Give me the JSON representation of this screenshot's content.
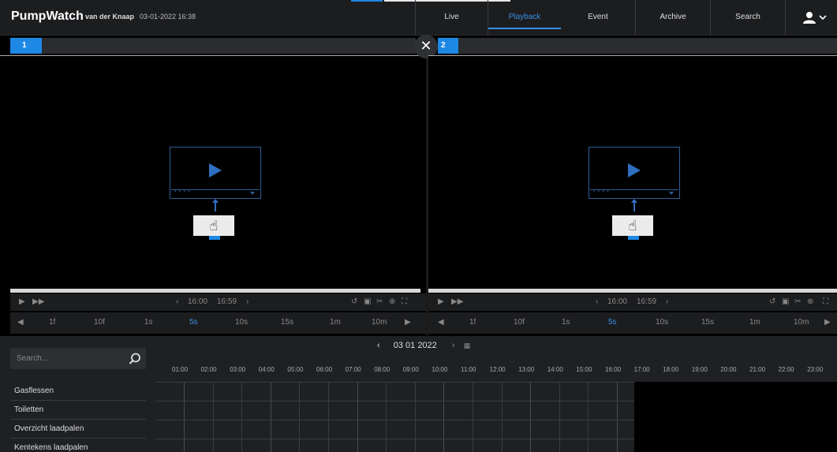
{
  "header": {
    "brand": "PumpWatch",
    "site": "van der Knaap",
    "datetime": "03-01-2022 16:38"
  },
  "nav": [
    {
      "label": "Live",
      "active": false
    },
    {
      "label": "Playback",
      "active": true
    },
    {
      "label": "Event",
      "active": false
    },
    {
      "label": "Archive",
      "active": false
    },
    {
      "label": "Search",
      "active": false
    }
  ],
  "panes": [
    {
      "number": "1",
      "time_start": "16:00",
      "time_end": "16:59"
    },
    {
      "number": "2",
      "time_start": "16:00",
      "time_end": "16:59"
    }
  ],
  "speeds": [
    "1f",
    "10f",
    "1s",
    "5s",
    "10s",
    "15s",
    "1m",
    "10m"
  ],
  "selected_speed": "5s",
  "search": {
    "placeholder": "Search..."
  },
  "timeline": {
    "date": "03 01 2022",
    "hours": [
      "01:00",
      "02:00",
      "03:00",
      "04:00",
      "05:00",
      "06:00",
      "07:00",
      "08:00",
      "09:00",
      "10:00",
      "11:00",
      "12:00",
      "13:00",
      "14:00",
      "15:00",
      "16:00",
      "17:00",
      "18:00",
      "19:00",
      "20:00",
      "21:00",
      "22:00",
      "23:00"
    ]
  },
  "cameras": [
    "Gasflessen",
    "Toiletten",
    "Overzicht laadpalen",
    "Kentekens laadpalen"
  ],
  "colors": {
    "accent": "#1e88e5",
    "background": "#000000",
    "panel": "#1e2023"
  }
}
